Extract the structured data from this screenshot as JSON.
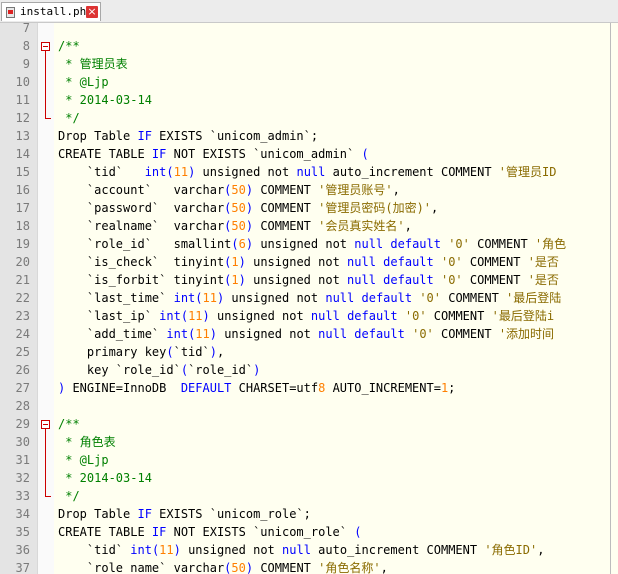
{
  "tab": {
    "title": "install.php",
    "close_glyph": "×"
  },
  "lines": [
    {
      "n": "7",
      "t": ""
    },
    {
      "n": "8",
      "t": "/**"
    },
    {
      "n": "9",
      "t": " * 管理员表"
    },
    {
      "n": "10",
      "t": " * @Ljp"
    },
    {
      "n": "11",
      "t": " * 2014-03-14"
    },
    {
      "n": "12",
      "t": " */"
    },
    {
      "n": "13",
      "t": "Drop Table IF EXISTS `unicom_admin`;"
    },
    {
      "n": "14",
      "t": "CREATE TABLE IF NOT EXISTS `unicom_admin` ("
    },
    {
      "n": "15",
      "t": "    `tid`   int(11) unsigned not null auto_increment COMMENT '管理员ID"
    },
    {
      "n": "16",
      "t": "    `account`   varchar(50) COMMENT '管理员账号',"
    },
    {
      "n": "17",
      "t": "    `password`  varchar(50) COMMENT '管理员密码(加密)',"
    },
    {
      "n": "18",
      "t": "    `realname`  varchar(50) COMMENT '会员真实姓名',"
    },
    {
      "n": "19",
      "t": "    `role_id`   smallint(6) unsigned not null default '0' COMMENT '角色"
    },
    {
      "n": "20",
      "t": "    `is_check`  tinyint(1) unsigned not null default '0' COMMENT '是否"
    },
    {
      "n": "21",
      "t": "    `is_forbit` tinyint(1) unsigned not null default '0' COMMENT '是否"
    },
    {
      "n": "22",
      "t": "    `last_time` int(11) unsigned not null default '0' COMMENT '最后登陆"
    },
    {
      "n": "23",
      "t": "    `last_ip` int(11) unsigned not null default '0' COMMENT '最后登陆i"
    },
    {
      "n": "24",
      "t": "    `add_time` int(11) unsigned not null default '0' COMMENT '添加时间"
    },
    {
      "n": "25",
      "t": "    primary key(`tid`),"
    },
    {
      "n": "26",
      "t": "    key `role_id`(`role_id`)"
    },
    {
      "n": "27",
      "t": ") ENGINE=InnoDB  DEFAULT CHARSET=utf8 AUTO_INCREMENT=1;"
    },
    {
      "n": "28",
      "t": ""
    },
    {
      "n": "29",
      "t": "/**"
    },
    {
      "n": "30",
      "t": " * 角色表"
    },
    {
      "n": "31",
      "t": " * @Ljp"
    },
    {
      "n": "32",
      "t": " * 2014-03-14"
    },
    {
      "n": "33",
      "t": " */"
    },
    {
      "n": "34",
      "t": "Drop Table IF EXISTS `unicom_role`;"
    },
    {
      "n": "35",
      "t": "CREATE TABLE IF NOT EXISTS `unicom_role` ("
    },
    {
      "n": "36",
      "t": "    `tid` int(11) unsigned not null auto_increment COMMENT '角色ID',"
    },
    {
      "n": "37",
      "t": "    `role_name` varchar(50) COMMENT '角色名称',"
    }
  ]
}
